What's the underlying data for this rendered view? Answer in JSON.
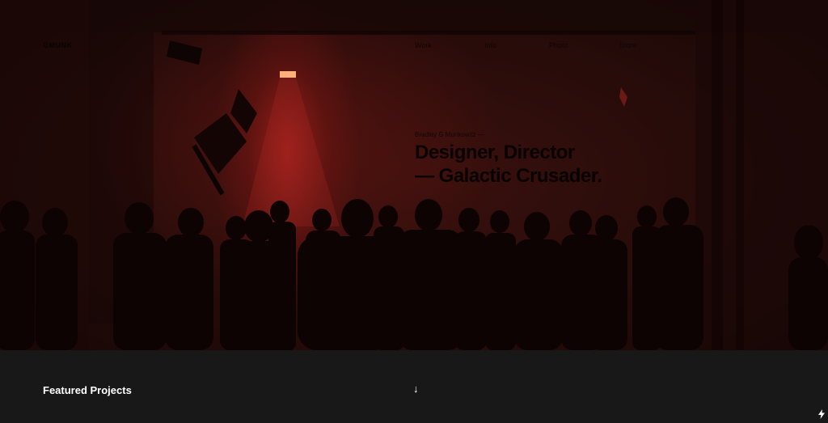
{
  "nav": {
    "logo": "GMUNK",
    "links": [
      {
        "label": "Work"
      },
      {
        "label": "Info"
      },
      {
        "label": "Photo"
      },
      {
        "label": "Store"
      }
    ]
  },
  "hero": {
    "kicker": "Bradley G Munkowitz —",
    "title_line1": "Designer, Director",
    "title_line2": "— Galactic Crusader."
  },
  "featured": {
    "title": "Featured Projects",
    "arrow": "↓"
  },
  "icons": [
    "down-arrow-icon",
    "lightning-bolt-icon"
  ],
  "colors": {
    "accent_red": "#cc2a22",
    "background": "#181818",
    "text_light": "#ffffff"
  }
}
